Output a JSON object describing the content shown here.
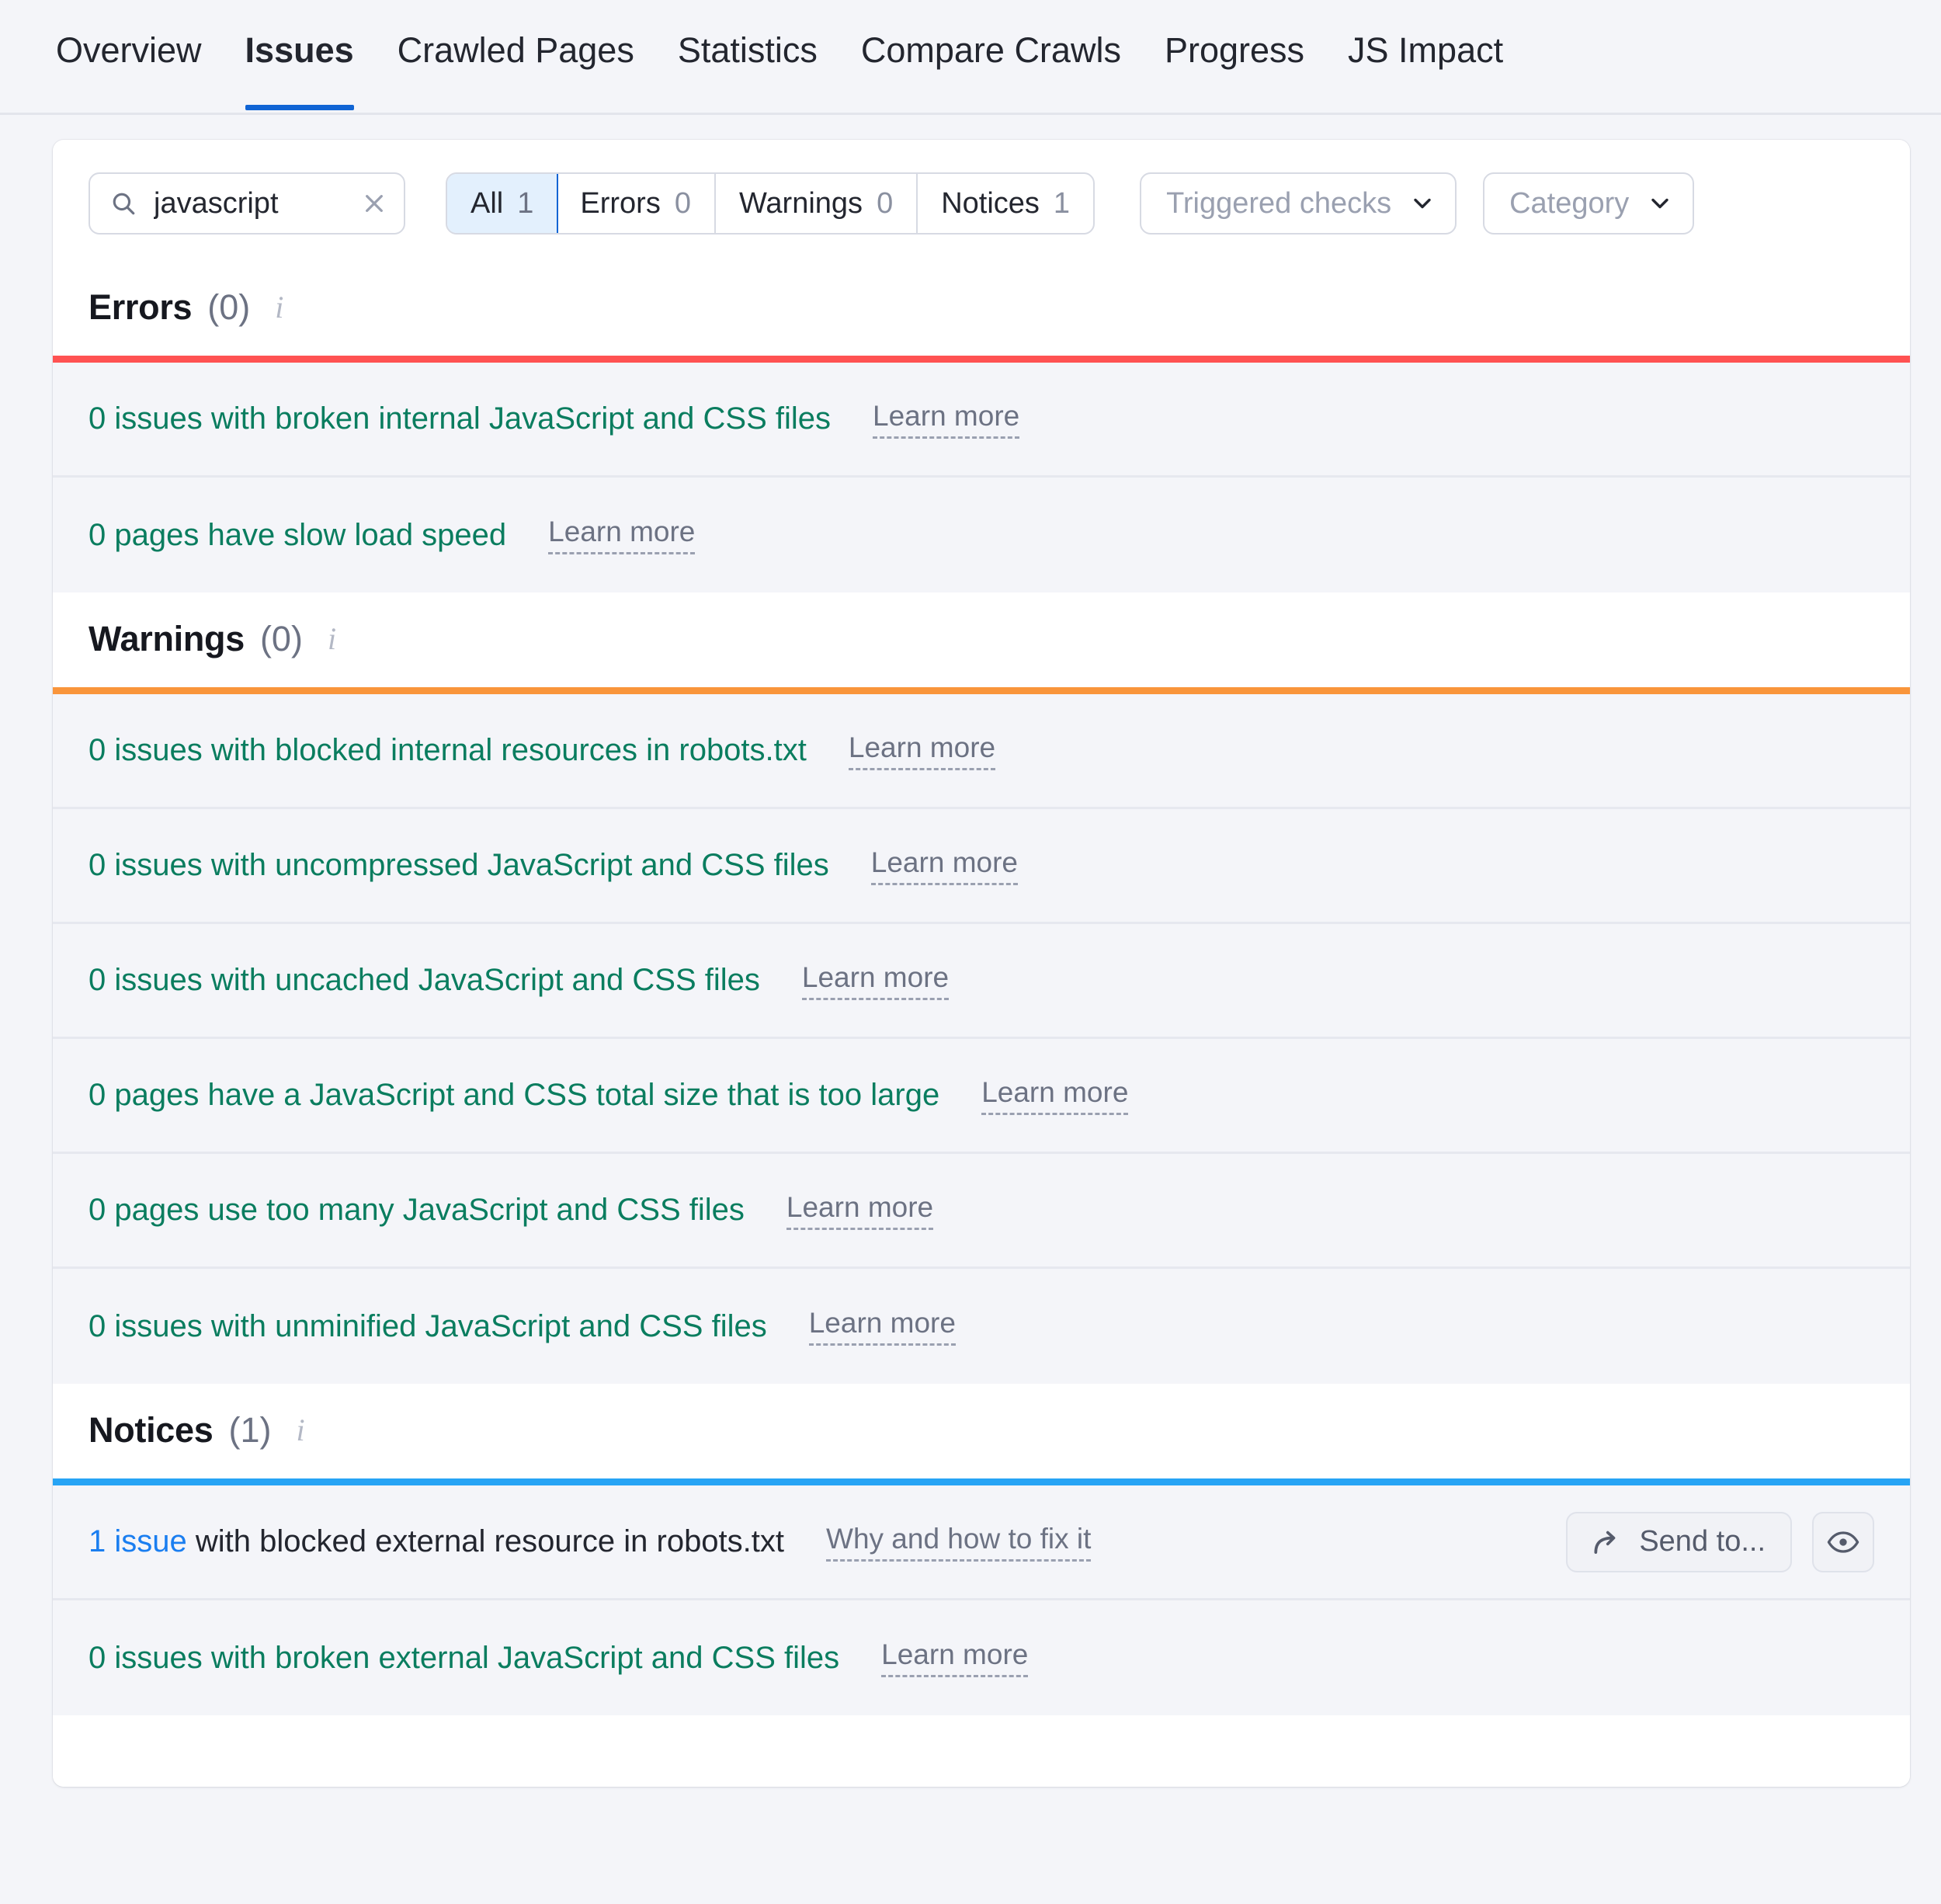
{
  "tabs": [
    {
      "label": "Overview",
      "active": false
    },
    {
      "label": "Issues",
      "active": true
    },
    {
      "label": "Crawled Pages",
      "active": false
    },
    {
      "label": "Statistics",
      "active": false
    },
    {
      "label": "Compare Crawls",
      "active": false
    },
    {
      "label": "Progress",
      "active": false
    },
    {
      "label": "JS Impact",
      "active": false
    }
  ],
  "filters": {
    "search": {
      "value": "javascript",
      "placeholder": "Search",
      "icon": "search-icon",
      "clear_icon": "clear-icon"
    },
    "segments": [
      {
        "label": "All",
        "count": "1",
        "active": true
      },
      {
        "label": "Errors",
        "count": "0",
        "active": false
      },
      {
        "label": "Warnings",
        "count": "0",
        "active": false
      },
      {
        "label": "Notices",
        "count": "1",
        "active": false
      }
    ],
    "dropdowns": [
      {
        "label": "Triggered checks"
      },
      {
        "label": "Category"
      }
    ]
  },
  "sections": [
    {
      "title": "Errors",
      "count": "(0)",
      "accent": "#ff5252",
      "rows": [
        {
          "text": "0 issues with broken internal JavaScript and CSS files",
          "link": "Learn more"
        },
        {
          "text": "0 pages have slow load speed",
          "link": "Learn more"
        }
      ]
    },
    {
      "title": "Warnings",
      "count": "(0)",
      "accent": "#f9953b",
      "rows": [
        {
          "text": "0 issues with blocked internal resources in robots.txt",
          "link": "Learn more"
        },
        {
          "text": "0 issues with uncompressed JavaScript and CSS files",
          "link": "Learn more"
        },
        {
          "text": "0 issues with uncached JavaScript and CSS files",
          "link": "Learn more"
        },
        {
          "text": "0 pages have a JavaScript and CSS total size that is too large",
          "link": "Learn more"
        },
        {
          "text": "0 pages use too many JavaScript and CSS files",
          "link": "Learn more"
        },
        {
          "text": "0 issues with unminified JavaScript and CSS files",
          "link": "Learn more"
        }
      ]
    },
    {
      "title": "Notices",
      "count": "(1)",
      "accent": "#27a4f5",
      "rows": [
        {
          "link_prefix": "1 issue",
          "text": " with blocked external resource in robots.txt",
          "link": "Why and how to fix it",
          "send_label": "Send to...",
          "has_actions": true
        },
        {
          "text": "0 issues with broken external JavaScript and CSS files",
          "link": "Learn more"
        }
      ]
    }
  ],
  "colors": {
    "accent_blue": "#1064d4",
    "error_red": "#ff5252",
    "warning_orange": "#f9953b",
    "notice_blue": "#27a4f5",
    "issue_green": "#0a7d5f",
    "link_blue": "#1a7ef0",
    "page_bg": "#f4f5f9"
  }
}
